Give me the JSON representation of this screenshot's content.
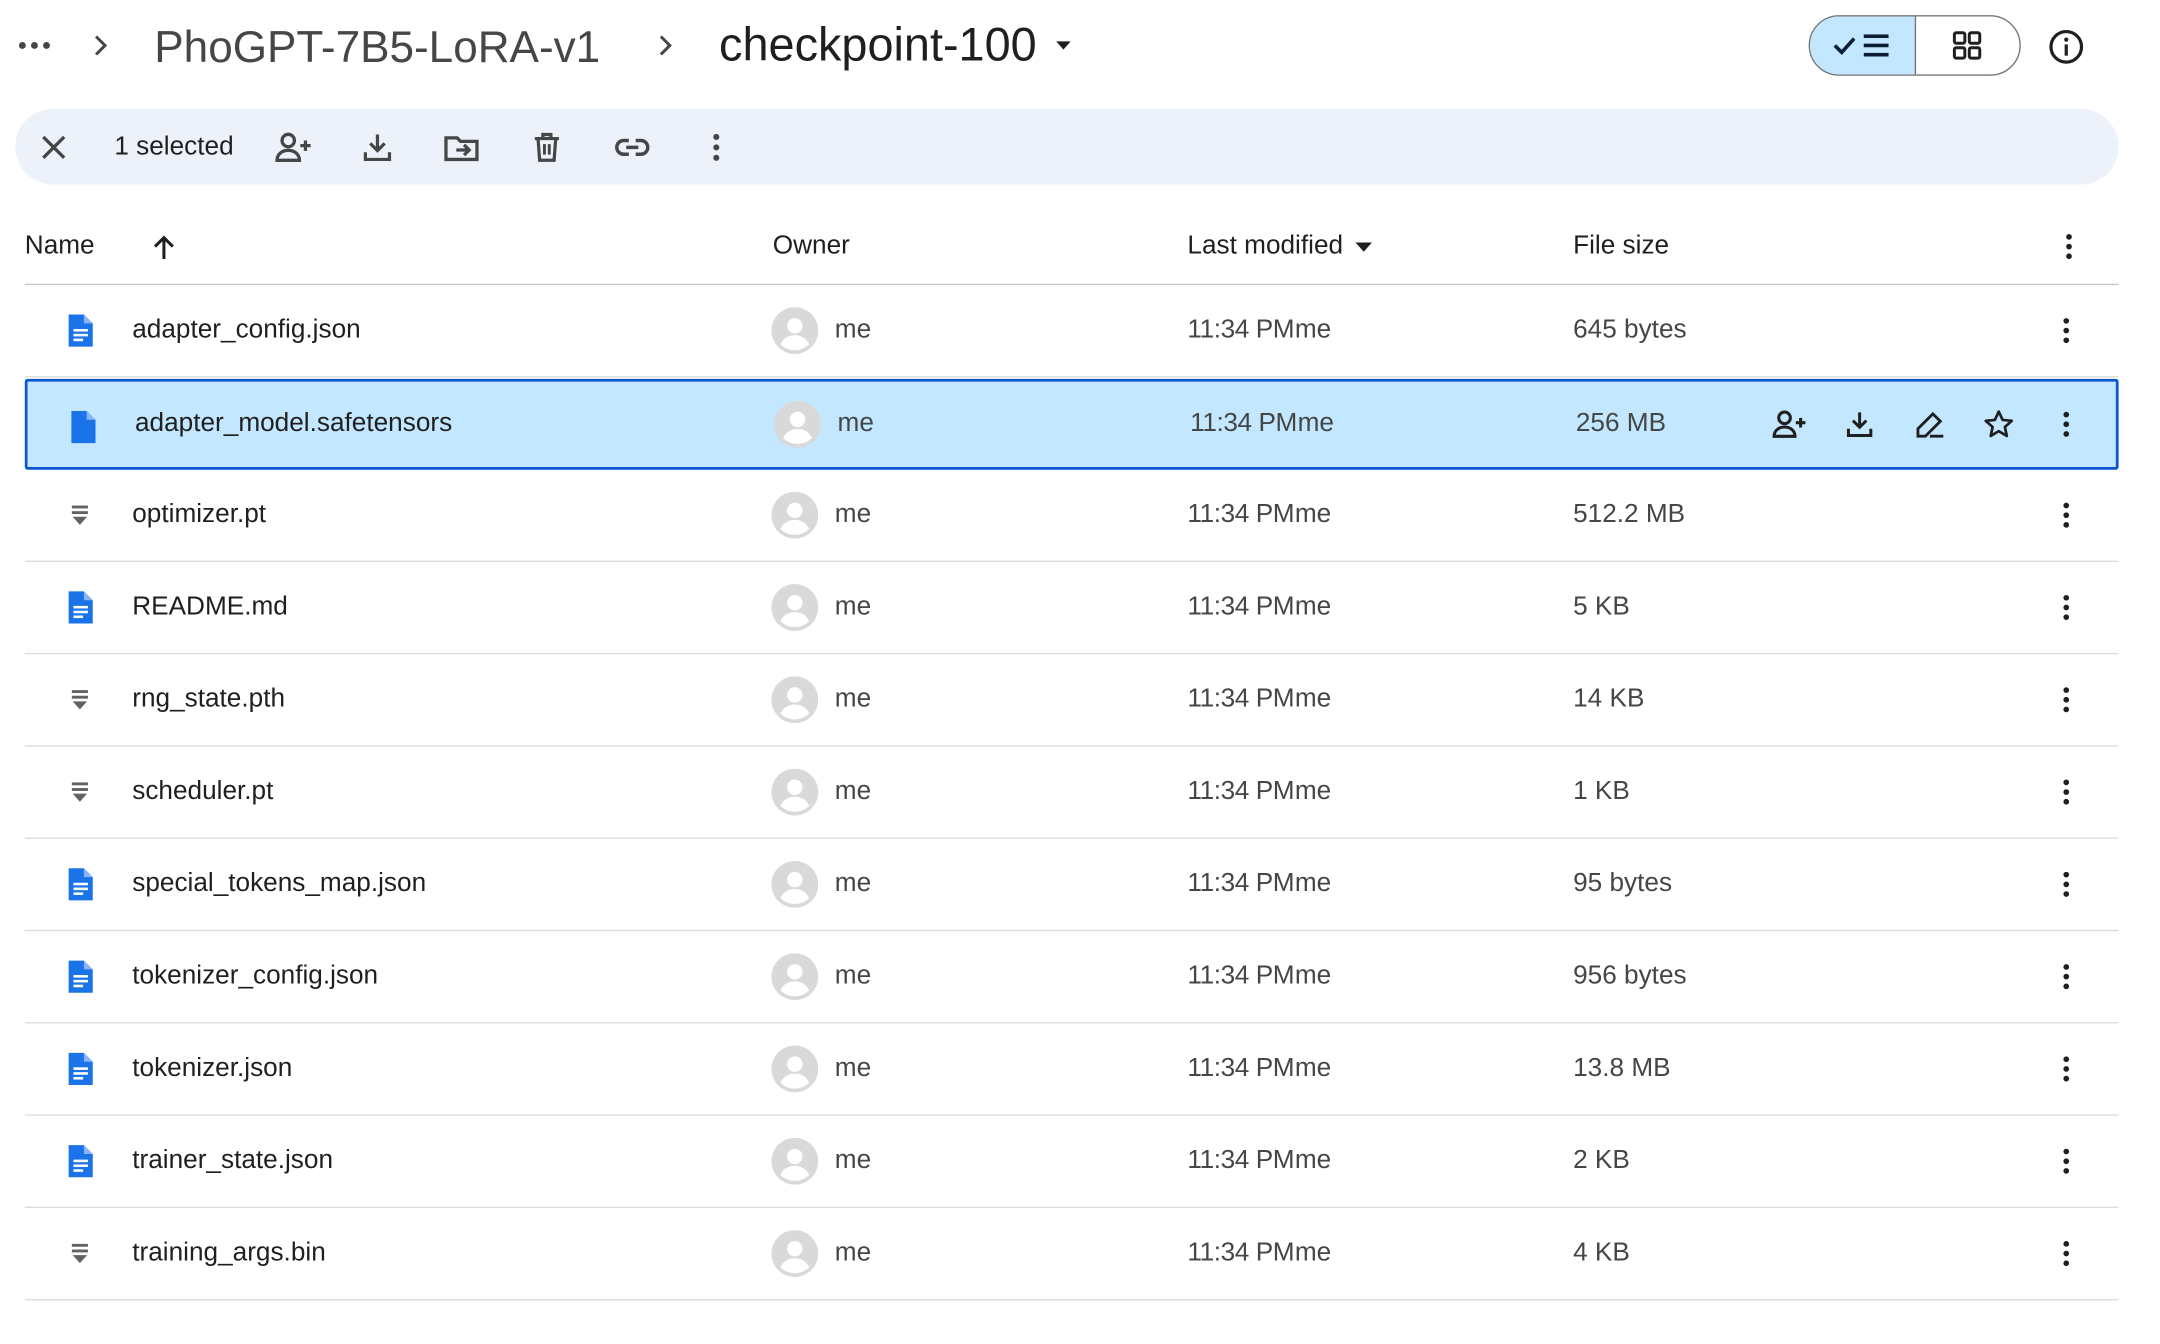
{
  "breadcrumb": {
    "parent": "PhoGPT-7B5-LoRA-v1",
    "current": "checkpoint-100"
  },
  "selection": {
    "count_label": "1 selected"
  },
  "columns": {
    "name": "Name",
    "owner": "Owner",
    "last_modified": "Last modified",
    "file_size": "File size"
  },
  "files": [
    {
      "name": "adapter_config.json",
      "icon": "doc-icon",
      "owner": "me",
      "time": "11:34 PM",
      "by": "me",
      "size": "645 bytes",
      "selected": false
    },
    {
      "name": "adapter_model.safetensors",
      "icon": "blank-file-icon",
      "owner": "me",
      "time": "11:34 PM",
      "by": "me",
      "size": "256 MB",
      "selected": true
    },
    {
      "name": "optimizer.pt",
      "icon": "binary-file-icon",
      "owner": "me",
      "time": "11:34 PM",
      "by": "me",
      "size": "512.2 MB",
      "selected": false
    },
    {
      "name": "README.md",
      "icon": "doc-icon",
      "owner": "me",
      "time": "11:34 PM",
      "by": "me",
      "size": "5 KB",
      "selected": false
    },
    {
      "name": "rng_state.pth",
      "icon": "binary-file-icon",
      "owner": "me",
      "time": "11:34 PM",
      "by": "me",
      "size": "14 KB",
      "selected": false
    },
    {
      "name": "scheduler.pt",
      "icon": "binary-file-icon",
      "owner": "me",
      "time": "11:34 PM",
      "by": "me",
      "size": "1 KB",
      "selected": false
    },
    {
      "name": "special_tokens_map.json",
      "icon": "doc-icon",
      "owner": "me",
      "time": "11:34 PM",
      "by": "me",
      "size": "95 bytes",
      "selected": false
    },
    {
      "name": "tokenizer_config.json",
      "icon": "doc-icon",
      "owner": "me",
      "time": "11:34 PM",
      "by": "me",
      "size": "956 bytes",
      "selected": false
    },
    {
      "name": "tokenizer.json",
      "icon": "doc-icon",
      "owner": "me",
      "time": "11:34 PM",
      "by": "me",
      "size": "13.8 MB",
      "selected": false
    },
    {
      "name": "trainer_state.json",
      "icon": "doc-icon",
      "owner": "me",
      "time": "11:34 PM",
      "by": "me",
      "size": "2 KB",
      "selected": false
    },
    {
      "name": "training_args.bin",
      "icon": "binary-file-icon",
      "owner": "me",
      "time": "11:34 PM",
      "by": "me",
      "size": "4 KB",
      "selected": false
    }
  ],
  "colors": {
    "accent": "#0b57d0",
    "selected_bg": "#c2e7ff",
    "toolbar_bg": "#edf2fa",
    "doc_blue": "#1a73e8",
    "icon_gray": "#444746"
  }
}
